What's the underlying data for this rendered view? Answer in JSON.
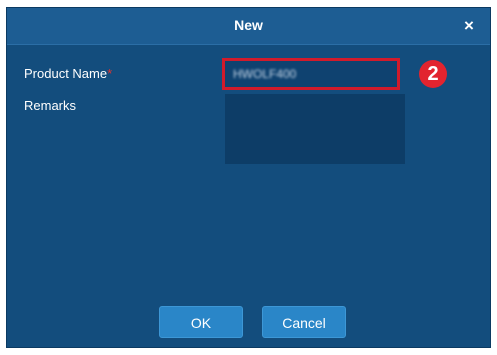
{
  "dialog": {
    "title": "New",
    "close_glyph": "×"
  },
  "form": {
    "product_name_label": "Product Name",
    "required_marker": "*",
    "product_name_value": "HWOLF400",
    "remarks_label": "Remarks",
    "remarks_value": ""
  },
  "annotation": {
    "step_number": "2",
    "step_color": "#e2242f"
  },
  "buttons": {
    "ok_label": "OK",
    "cancel_label": "Cancel"
  },
  "colors": {
    "dialog_bg": "#134d7d",
    "titlebar_bg": "#1d5d93",
    "button_bg": "#2a86c8",
    "highlight_border": "#d11b2b"
  }
}
